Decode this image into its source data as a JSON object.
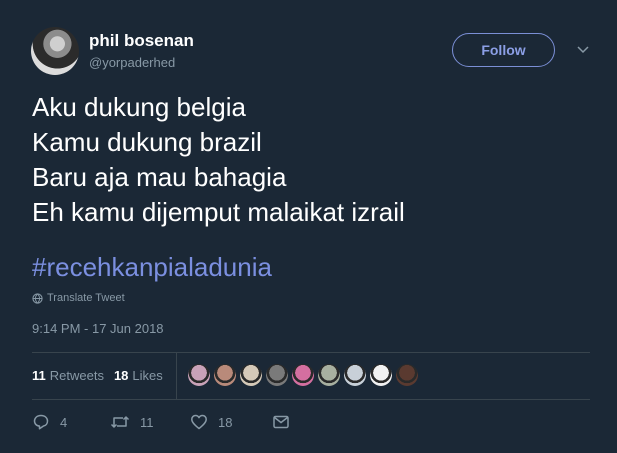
{
  "user": {
    "display_name": "phil bosenan",
    "handle": "@yorpaderhed"
  },
  "follow_label": "Follow",
  "tweet": {
    "lines": [
      "Aku dukung belgia",
      "Kamu dukung brazil",
      "Baru aja mau bahagia",
      "Eh kamu dijemput malaikat izrail"
    ],
    "hashtag": "#recehkanpialadunia"
  },
  "translate_label": "Translate Tweet",
  "timestamp": "9:14 PM - 17 Jun 2018",
  "stats": {
    "retweets_count": "11",
    "retweets_label": "Retweets",
    "likes_count": "18",
    "likes_label": "Likes"
  },
  "liker_avatars": [
    {
      "color": "#c9a2b8"
    },
    {
      "color": "#b98a7a"
    },
    {
      "color": "#d5c9b8"
    },
    {
      "color": "#7a7a7a"
    },
    {
      "color": "#d46fa0"
    },
    {
      "color": "#a8b0a0"
    },
    {
      "color": "#c8d0d8"
    },
    {
      "color": "#f2f2f2"
    },
    {
      "color": "#5a3a30"
    }
  ],
  "actions": {
    "reply_count": "4",
    "retweet_count": "11",
    "like_count": "18"
  },
  "colors": {
    "background": "#1b2836",
    "link": "#7b8fe0",
    "muted": "#8899a6"
  },
  "icons": [
    "caret-down-icon",
    "globe-icon",
    "reply-icon",
    "retweet-icon",
    "heart-icon",
    "direct-message-icon"
  ]
}
